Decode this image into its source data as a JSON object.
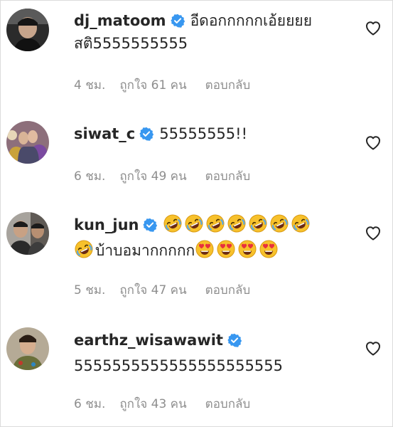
{
  "colors": {
    "verified": "#3897f0",
    "meta_text": "#8e8e8e",
    "text": "#262626",
    "emoji_face": "#f7c12b",
    "heart_eyes": "#e8313d",
    "tear": "#5aa9e6"
  },
  "comments": [
    {
      "username": "dj_matoom",
      "verified": true,
      "text_line1": "อีดอกกกกกเอ้ยยยย",
      "text_line2": "สติ5555555555",
      "time": "4 ชม.",
      "likes": "ถูกใจ 61 คน",
      "reply": "ตอบกลับ",
      "avatar_icon": "profile-avatar-dark"
    },
    {
      "username": "siwat_c",
      "verified": true,
      "text_line1": "55555555!!",
      "time": "6 ชม.",
      "likes": "ถูกใจ 49 คน",
      "reply": "ตอบกลับ",
      "avatar_icon": "profile-avatar-couple"
    },
    {
      "username": "kun_jun",
      "verified": true,
      "emoji_line1": [
        "rofl-emoji",
        "rofl-emoji",
        "rofl-emoji",
        "rofl-emoji",
        "rofl-emoji",
        "rofl-emoji",
        "rofl-emoji"
      ],
      "text_prefix_emoji": "rofl-emoji",
      "text_line2": "บ้าบอมากกกกก",
      "emoji_line2_after": [
        "heart-eyes-emoji",
        "heart-eyes-emoji",
        "heart-eyes-emoji",
        "heart-eyes-emoji"
      ],
      "time": "5 ชม.",
      "likes": "ถูกใจ 47 คน",
      "reply": "ตอบกลับ",
      "avatar_icon": "profile-avatar-group"
    },
    {
      "username": "earthz_wisawawit",
      "verified": true,
      "text_line2": "5555555555555555555555",
      "time": "6 ชม.",
      "likes": "ถูกใจ 43 คน",
      "reply": "ตอบกลับ",
      "avatar_icon": "profile-avatar-man"
    }
  ]
}
